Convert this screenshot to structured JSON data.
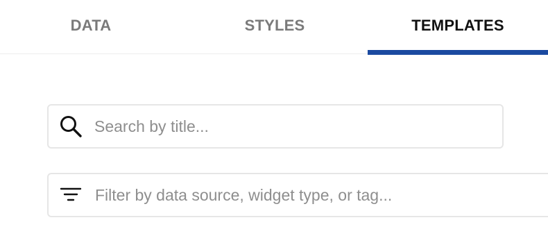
{
  "tabs": [
    {
      "label": "DATA",
      "active": false
    },
    {
      "label": "STYLES",
      "active": false
    },
    {
      "label": "TEMPLATES",
      "active": true
    }
  ],
  "search": {
    "placeholder": "Search by title...",
    "value": "",
    "icon": "search-icon"
  },
  "filter": {
    "placeholder": "Filter by data source, widget type, or tag...",
    "value": "",
    "icon": "filter-icon"
  },
  "colors": {
    "active_tab_indicator": "#1b4aa0",
    "active_tab_text": "#111111",
    "inactive_tab_text": "#7a7a7a",
    "placeholder_text": "#8e8e8e",
    "field_border": "#e6e6e6"
  }
}
